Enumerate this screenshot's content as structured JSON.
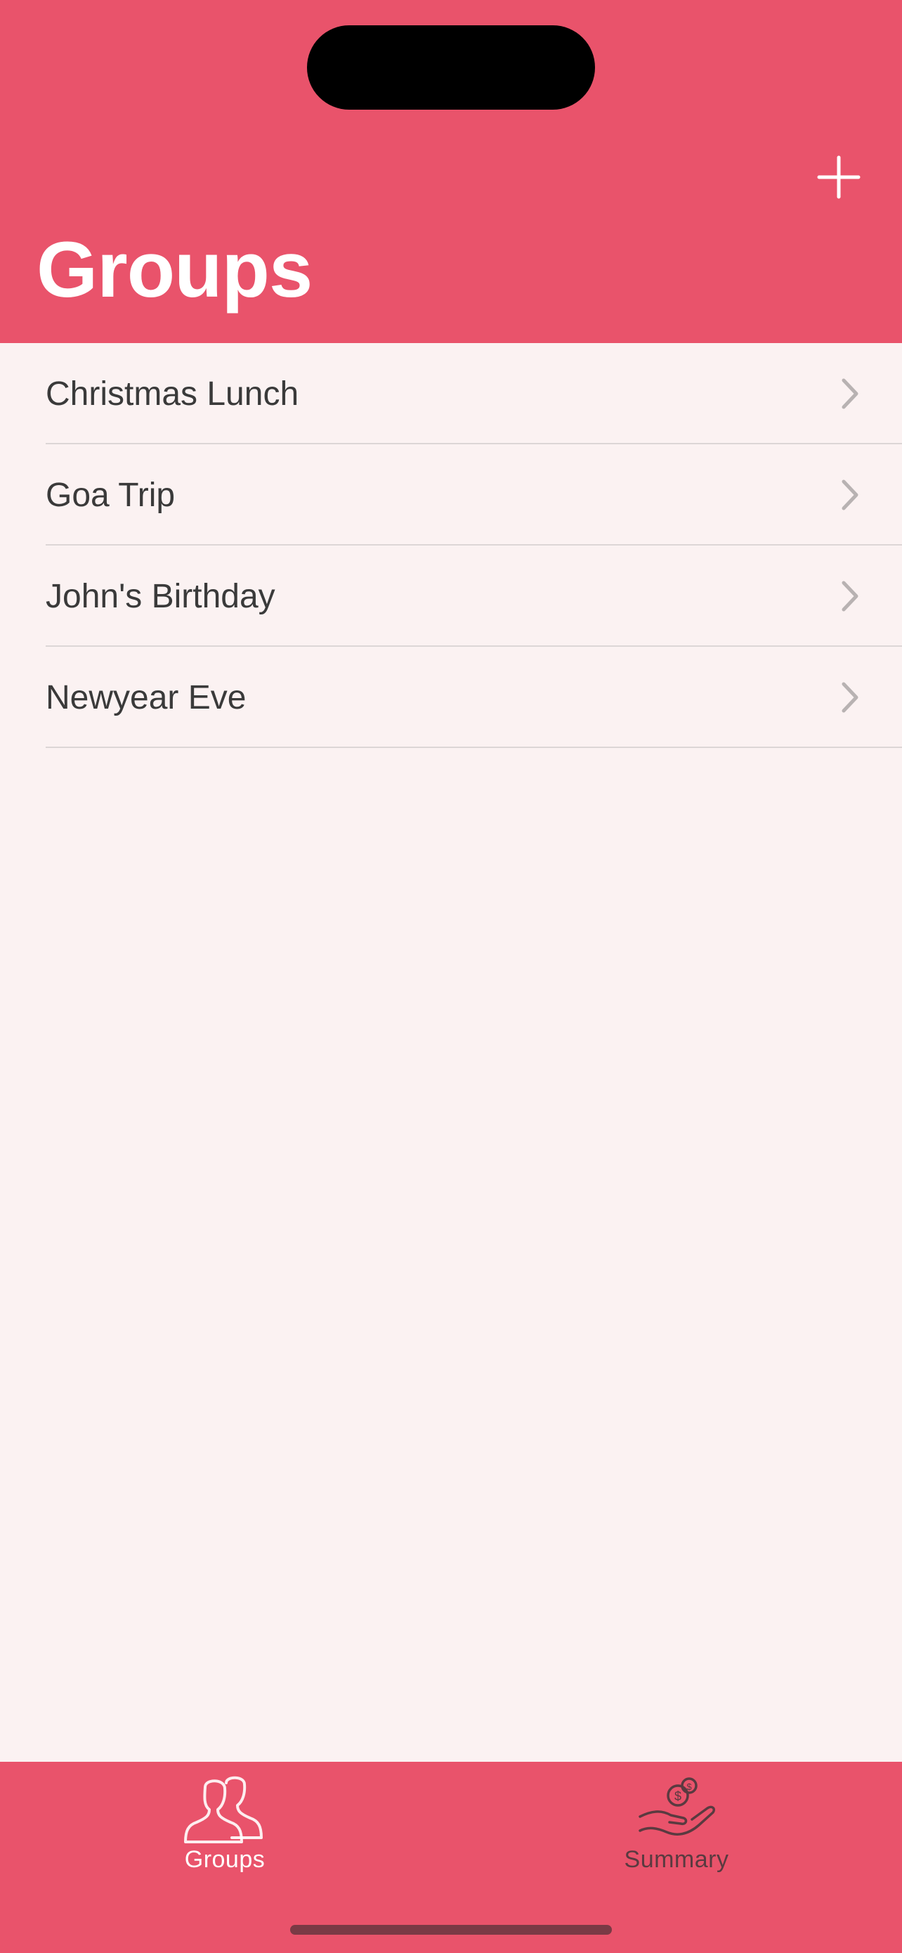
{
  "header": {
    "title": "Groups",
    "add_icon": "plus-icon"
  },
  "groups": [
    {
      "label": "Christmas Lunch"
    },
    {
      "label": "Goa Trip"
    },
    {
      "label": "John's Birthday"
    },
    {
      "label": "Newyear Eve"
    }
  ],
  "tabbar": {
    "tabs": [
      {
        "label": "Groups",
        "icon": "people-icon",
        "selected": true
      },
      {
        "label": "Summary",
        "icon": "hand-coins-icon",
        "selected": false
      }
    ]
  },
  "colors": {
    "accent": "#E9536B",
    "background": "#FBF2F2",
    "text": "#3A3A3A",
    "separator": "#DCD6D6"
  }
}
